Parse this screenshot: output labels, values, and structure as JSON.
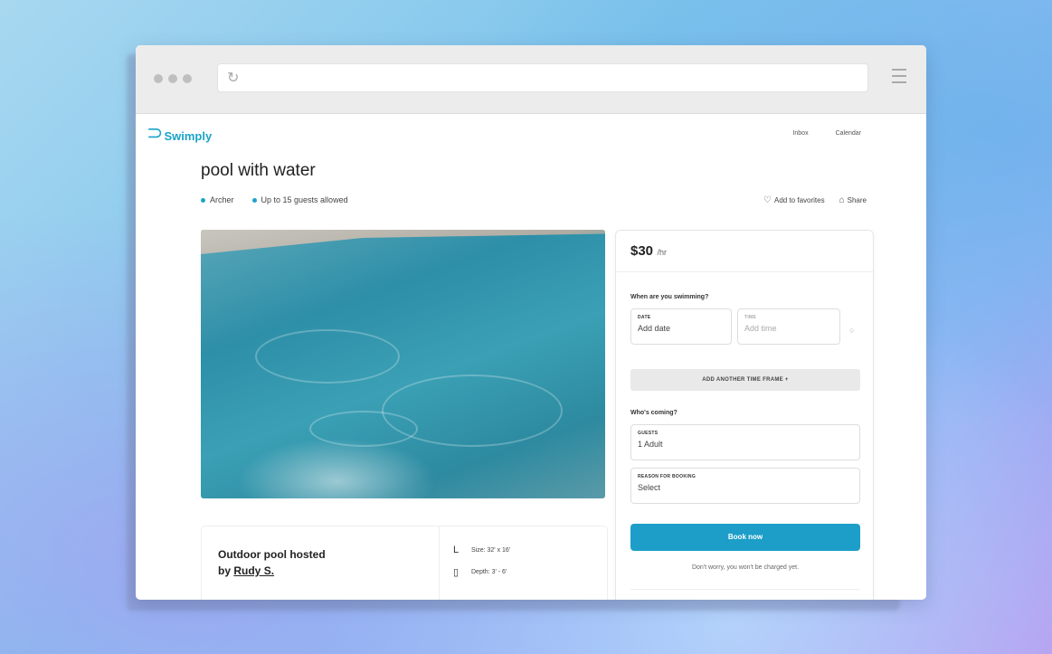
{
  "app": {
    "logo_text": "Swimply"
  },
  "nav": {
    "items": [
      "Inbox",
      "Calendar"
    ]
  },
  "listing": {
    "title": "pool with water",
    "location": "Archer",
    "guests": "Up to 15 guests allowed",
    "favorite_label": "Add to favorites",
    "share_label": "Share"
  },
  "booking": {
    "price": "$30",
    "per": "/hr",
    "when_question": "When are you swimming?",
    "date_label": "DATE",
    "date_placeholder": "Add date",
    "time_label": "TIME",
    "time_placeholder": "Add time",
    "add_slot_label": "ADD ANOTHER TIME FRAME +",
    "who_question": "Who's coming?",
    "guests_label": "GUESTS",
    "guests_value": "1 Adult",
    "reason_label": "REASON FOR BOOKING",
    "reason_value": "Select",
    "book_button": "Book now",
    "note": "Don't worry, you won't be charged yet."
  },
  "host": {
    "title_prefix": "Outdoor pool hosted",
    "by": "by",
    "name": "Rudy S.",
    "size": "Size: 32' x 16'",
    "depth": "Depth: 3' - 6'"
  },
  "colors": {
    "accent": "#1c9ec8",
    "logo": "#1aa3c8"
  },
  "icons": {
    "reload": "reload-icon",
    "menu": "hamburger-icon",
    "heart": "heart-icon",
    "share": "share-icon",
    "clock": "clock-icon",
    "size": "ruler-icon",
    "depth": "depth-icon"
  }
}
